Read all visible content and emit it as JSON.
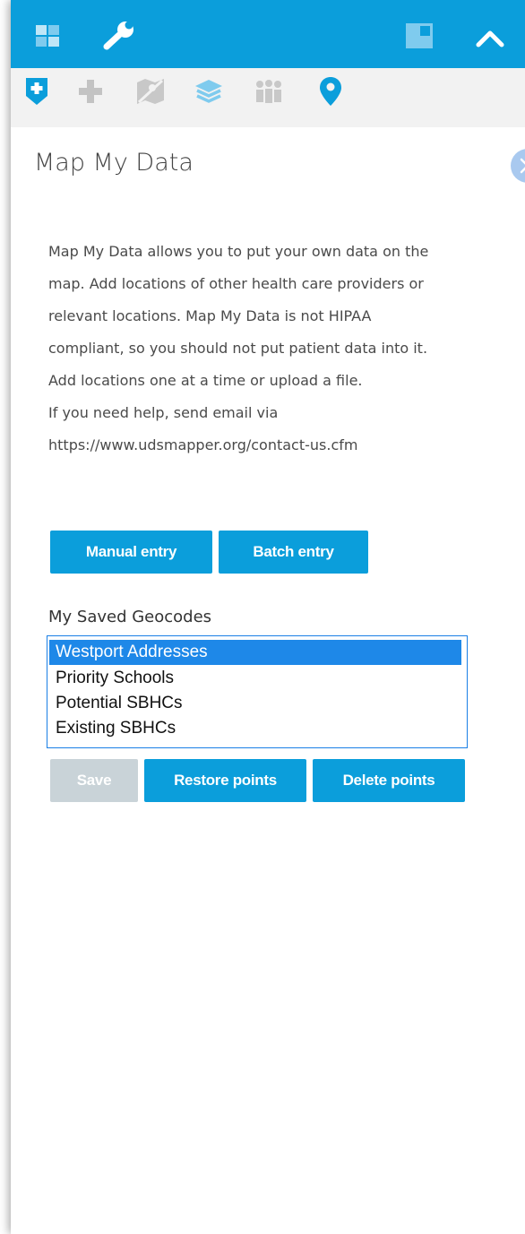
{
  "topbar": {
    "icons": [
      "grid-icon",
      "wrench-icon",
      "window-icon",
      "chevron-up-icon"
    ],
    "accent": "#0b9edb"
  },
  "toolbar": {
    "icons": [
      "shield-plus-icon",
      "plus-icon",
      "map-icon",
      "layers-icon",
      "people-icon",
      "map-pin-icon"
    ]
  },
  "panel": {
    "title": "Map My Data",
    "description_lines": [
      "Map My Data allows you to put your own data on the",
      "map. Add locations of other health care providers or",
      "relevant locations. Map My Data is not HIPAA",
      "compliant, so you should not put patient data into it.",
      "Add locations one at a time or upload a file.",
      "If you need help, send email via",
      "https://www.udsmapper.org/contact-us.cfm"
    ],
    "manual_entry_label": "Manual entry",
    "batch_entry_label": "Batch entry",
    "saved_geocodes_label": "My Saved Geocodes",
    "saved_geocodes": [
      "Westport Addresses",
      "Priority Schools",
      "Potential SBHCs",
      "Existing SBHCs"
    ],
    "selected_geocode": "Westport Addresses",
    "save_label": "Save",
    "restore_label": "Restore points",
    "delete_label": "Delete points"
  }
}
